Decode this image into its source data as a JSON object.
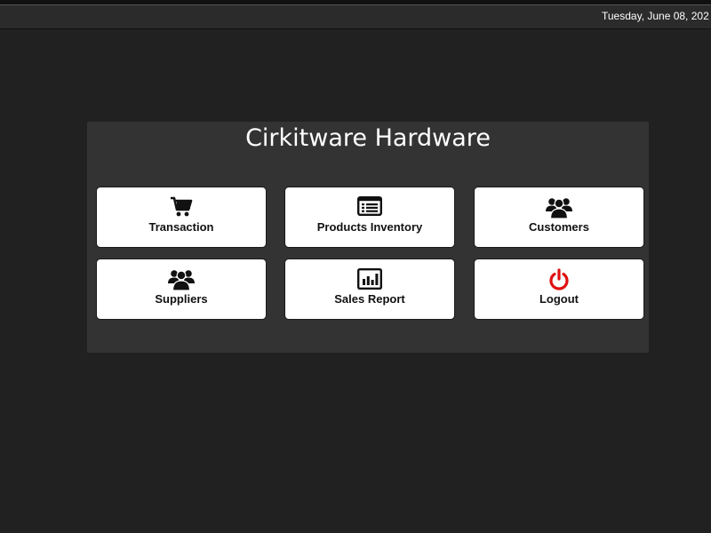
{
  "header": {
    "date": "Tuesday, June 08, 202"
  },
  "app": {
    "title": "Cirkitware Hardware"
  },
  "menu": {
    "transaction": {
      "label": "Transaction",
      "icon": "cart-icon"
    },
    "products_inventory": {
      "label": "Products Inventory",
      "icon": "inventory-list-icon"
    },
    "customers": {
      "label": "Customers",
      "icon": "users-icon"
    },
    "suppliers": {
      "label": "Suppliers",
      "icon": "users-icon"
    },
    "sales_report": {
      "label": "Sales Report",
      "icon": "bar-chart-icon"
    },
    "logout": {
      "label": "Logout",
      "icon": "power-icon"
    }
  },
  "colors": {
    "background": "#212121",
    "panel": "#333333",
    "tile": "#ffffff",
    "logout_icon": "#e01010"
  }
}
